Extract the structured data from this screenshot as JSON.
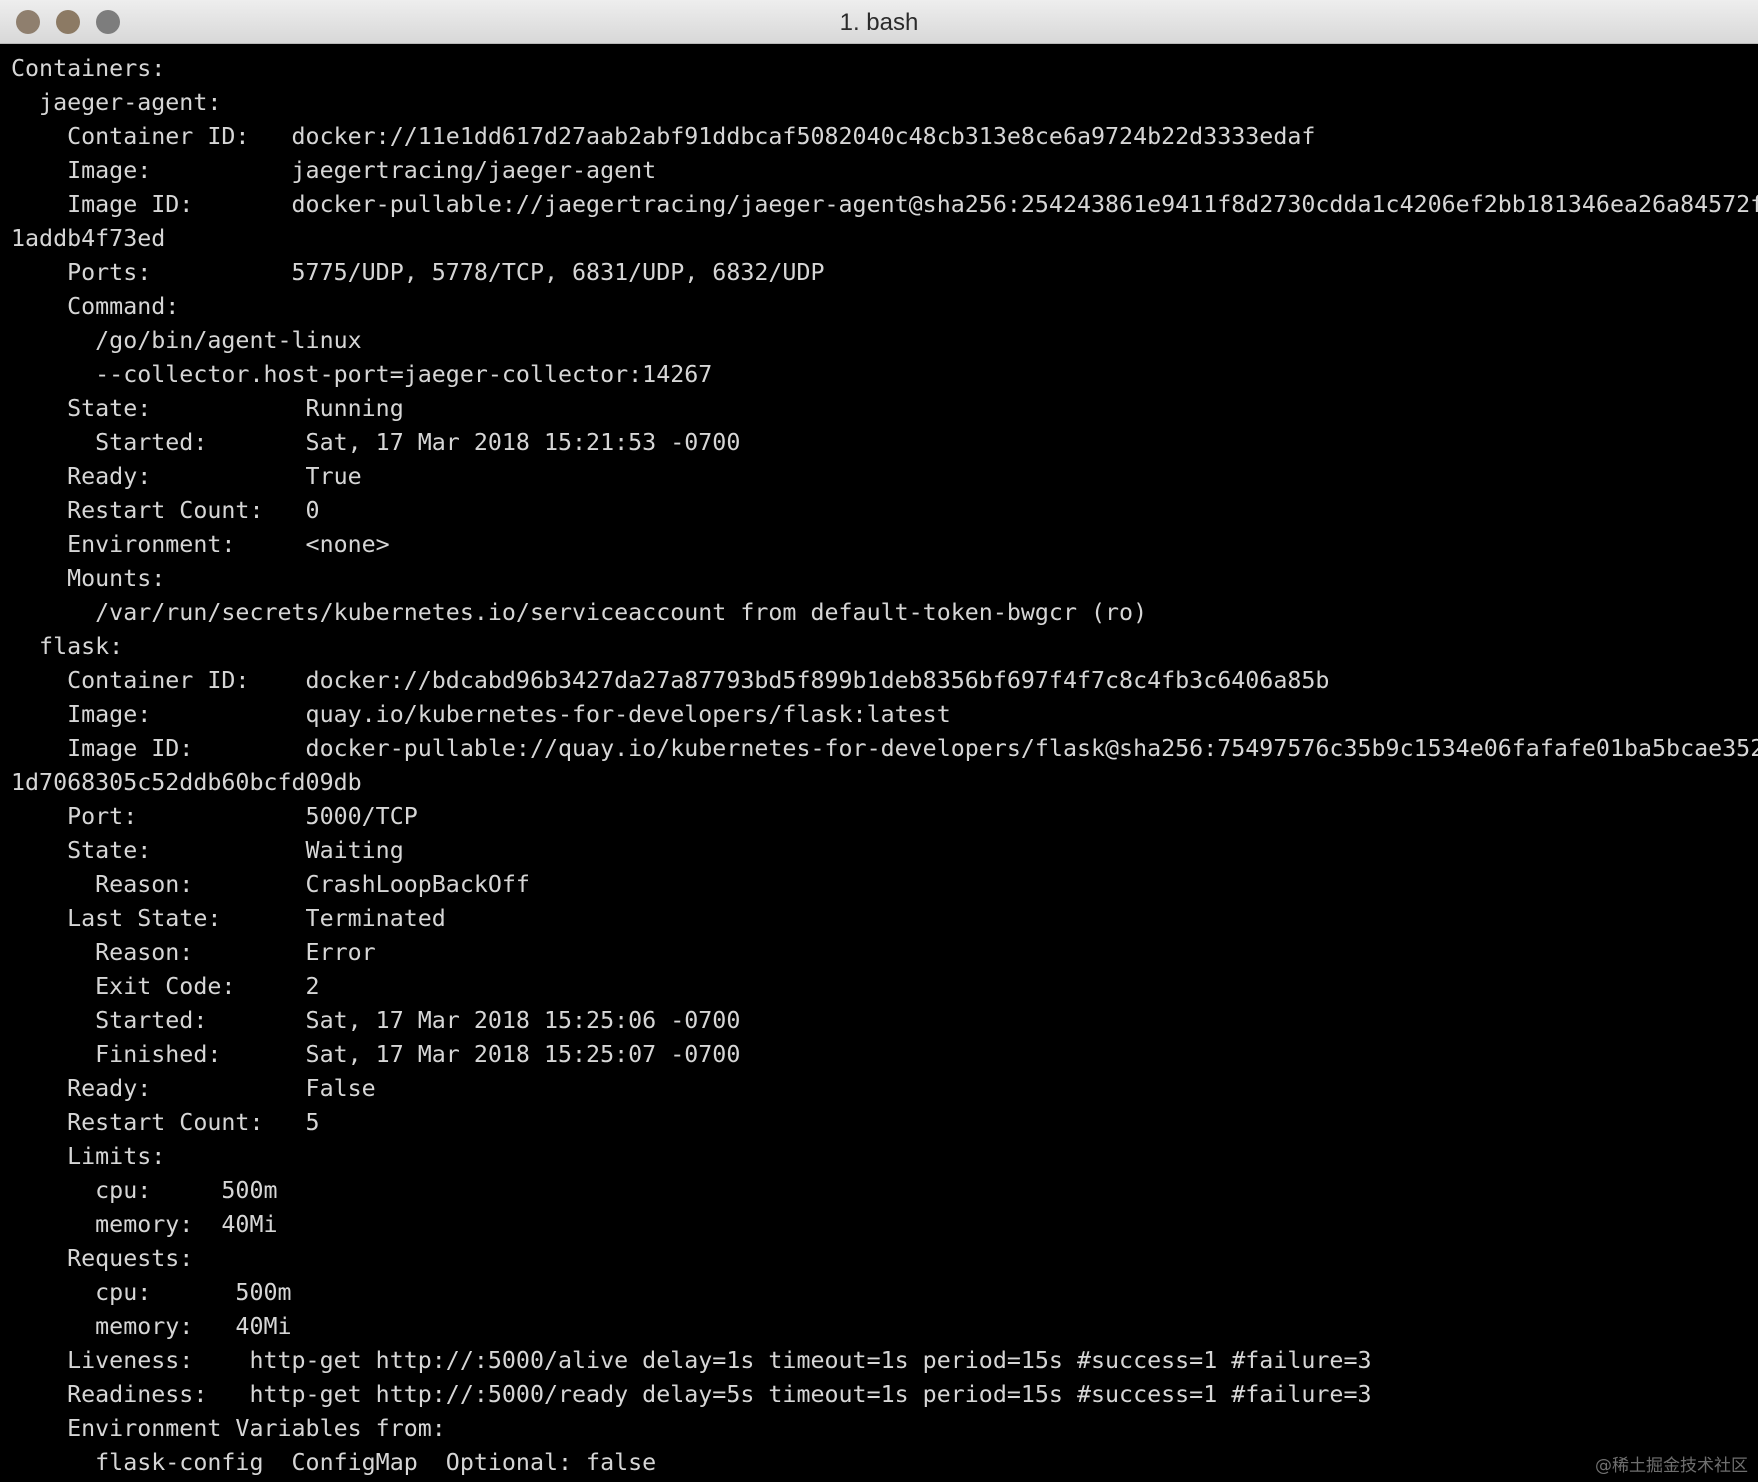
{
  "window": {
    "title": "1. bash",
    "buttons": {
      "close": {
        "label": "close",
        "color": "#8f7f6e"
      },
      "minimize": {
        "label": "minimize",
        "color": "#8c7a64"
      },
      "zoom": {
        "label": "zoom",
        "color": "#7d7d7d"
      }
    }
  },
  "terminal": {
    "text_color": "#d6d6d6",
    "background": "#000000",
    "lines": [
      "Containers:",
      "  jaeger-agent:",
      "    Container ID:   docker://11e1dd617d27aab2abf91ddbcaf5082040c48cb313e8ce6a9724b22d3333edaf",
      "    Image:          jaegertracing/jaeger-agent",
      "    Image ID:       docker-pullable://jaegertracing/jaeger-agent@sha256:254243861e9411f8d2730cdda1c4206ef2bb181346ea26a84572f",
      "1addb4f73ed",
      "    Ports:          5775/UDP, 5778/TCP, 6831/UDP, 6832/UDP",
      "    Command:",
      "      /go/bin/agent-linux",
      "      --collector.host-port=jaeger-collector:14267",
      "    State:           Running",
      "      Started:       Sat, 17 Mar 2018 15:21:53 -0700",
      "    Ready:           True",
      "    Restart Count:   0",
      "    Environment:     <none>",
      "    Mounts:",
      "      /var/run/secrets/kubernetes.io/serviceaccount from default-token-bwgcr (ro)",
      "  flask:",
      "    Container ID:    docker://bdcabd96b3427da27a87793bd5f899b1deb8356bf697f4f7c8c4fb3c6406a85b",
      "    Image:           quay.io/kubernetes-for-developers/flask:latest",
      "    Image ID:        docker-pullable://quay.io/kubernetes-for-developers/flask@sha256:75497576c35b9c1534e06fafafe01ba5bcae352",
      "1d7068305c52ddb60bcfd09db",
      "    Port:            5000/TCP",
      "    State:           Waiting",
      "      Reason:        CrashLoopBackOff",
      "    Last State:      Terminated",
      "      Reason:        Error",
      "      Exit Code:     2",
      "      Started:       Sat, 17 Mar 2018 15:25:06 -0700",
      "      Finished:      Sat, 17 Mar 2018 15:25:07 -0700",
      "    Ready:           False",
      "    Restart Count:   5",
      "    Limits:",
      "      cpu:     500m",
      "      memory:  40Mi",
      "    Requests:",
      "      cpu:      500m",
      "      memory:   40Mi",
      "    Liveness:    http-get http://:5000/alive delay=1s timeout=1s period=15s #success=1 #failure=3",
      "    Readiness:   http-get http://:5000/ready delay=5s timeout=1s period=15s #success=1 #failure=3",
      "    Environment Variables from:",
      "      flask-config  ConfigMap  Optional: false"
    ]
  },
  "watermark": "@稀土掘金技术社区"
}
